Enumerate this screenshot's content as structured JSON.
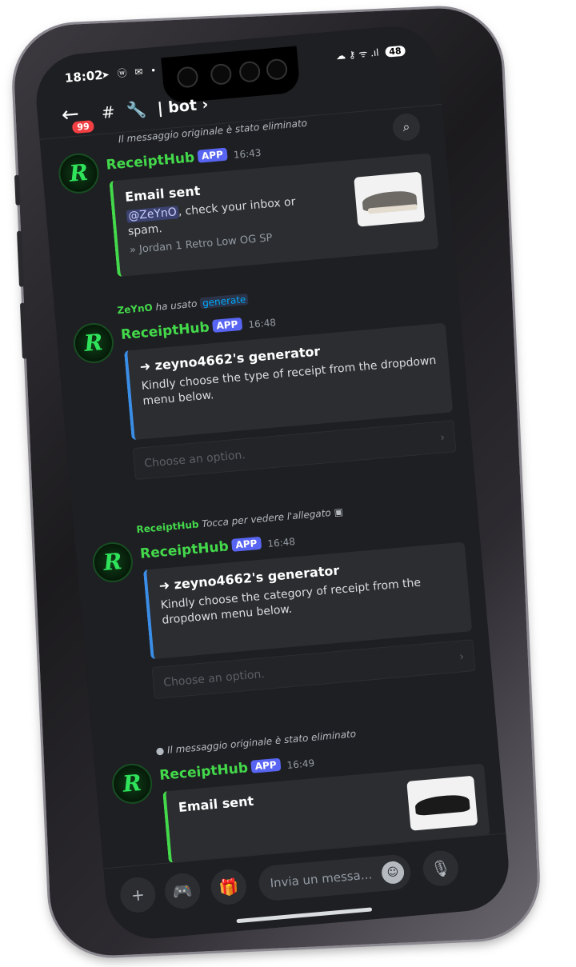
{
  "status": {
    "time": "18:02",
    "left_icons": "➤ ⓦ ✉ •",
    "right_icons": "☁ ⚷ ᯤ .ıl",
    "battery": "48"
  },
  "header": {
    "back_icon": "←",
    "badge": "99",
    "channel_icons": "# 🔧",
    "channel_name": "| bot ›",
    "search_icon": "⌕"
  },
  "messages": [
    {
      "reply": "Il messaggio originale è stato eliminato",
      "author": "ReceiptHub",
      "app_tag": "APP",
      "time": "16:43",
      "embed": {
        "title": "Email sent",
        "mention": "@ZeYnO",
        "desc": ", check your inbox or spam.",
        "sub": "» Jordan 1 Retro Low OG SP"
      }
    },
    {
      "reply_user": "ZeYnO",
      "reply_text": "ha usato",
      "reply_cmd": "generate",
      "author": "ReceiptHub",
      "app_tag": "APP",
      "time": "16:48",
      "embed": {
        "title": "➜ zeyno4662's generator",
        "desc": "Kindly choose the type of receipt from the dropdown menu below."
      },
      "select": "Choose an option."
    },
    {
      "reply_user": "ReceiptHub",
      "reply_text": "Tocca per vedere l'allegato",
      "author": "ReceiptHub",
      "app_tag": "APP",
      "time": "16:48",
      "embed": {
        "title": "➜ zeyno4662's generator",
        "desc": "Kindly choose the category of receipt from the dropdown menu below."
      },
      "select": "Choose an option."
    },
    {
      "reply": "Il messaggio originale è stato eliminato",
      "author": "ReceiptHub",
      "app_tag": "APP",
      "time": "16:49",
      "embed": {
        "title": "Email sent"
      }
    }
  ],
  "avatar_letter": "R",
  "input": {
    "plus": "+",
    "games": "🎮",
    "gift": "🎁",
    "placeholder": "Invia un messa...",
    "emoji": "☺",
    "mic": "🎙"
  }
}
